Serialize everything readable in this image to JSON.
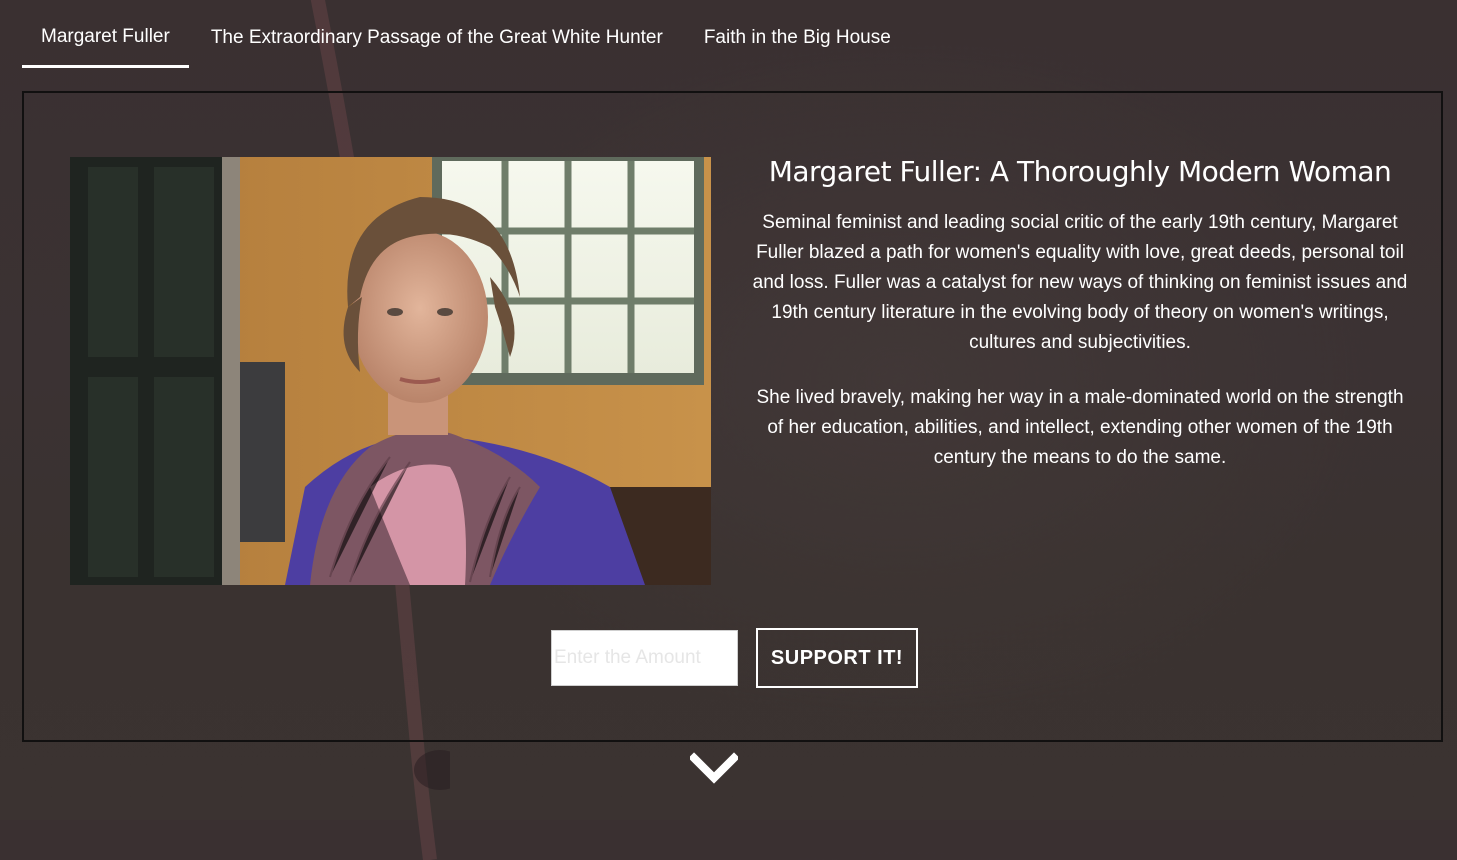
{
  "tabs": [
    {
      "label": "Margaret Fuller",
      "active": true
    },
    {
      "label": "The Extraordinary Passage of the Great White Hunter",
      "active": false
    },
    {
      "label": "Faith in the Big House",
      "active": false
    }
  ],
  "feature": {
    "title": "Margaret Fuller: A Thoroughly Modern Woman",
    "paragraphs": [
      "Seminal feminist and leading social critic of the early 19th century, Margaret Fuller blazed a path for women's equality with love, great deeds, personal toil and loss. Fuller was a catalyst for new ways of thinking on feminist issues and 19th century literature in the evolving body of theory on women's writings, cultures and subjectivities.",
      "She lived bravely, making her way in a male-dominated world on the strength of her education, abilities, and intellect, extending other women of the 19th century the means to do the same."
    ]
  },
  "support": {
    "amount_placeholder": "Enter the Amount",
    "amount_value": "",
    "button_label": "SUPPORT IT!"
  },
  "icons": {
    "scroll": "chevron-down-icon"
  },
  "colors": {
    "background": "#3a3031",
    "text": "#ffffff",
    "panel_border": "#111010"
  }
}
